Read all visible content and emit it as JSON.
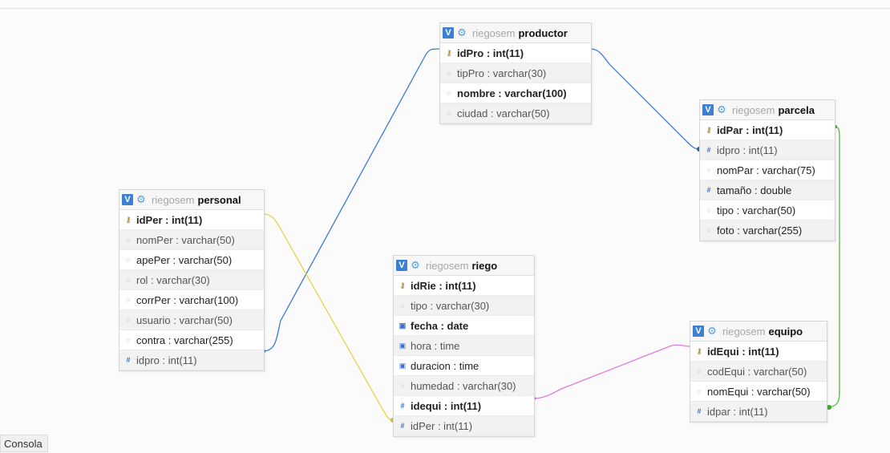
{
  "database": "riegosem",
  "tables": {
    "productor": {
      "name": "productor",
      "columns": [
        {
          "label": "idPro : int(11)",
          "icon": "key-icon"
        },
        {
          "label": "tipPro : varchar(30)",
          "icon": "column-icon"
        },
        {
          "label": "nombre : varchar(100)",
          "icon": "column-icon"
        },
        {
          "label": "ciudad : varchar(50)",
          "icon": "column-icon"
        }
      ]
    },
    "parcela": {
      "name": "parcela",
      "columns": [
        {
          "label": "idPar : int(11)",
          "icon": "key-icon"
        },
        {
          "label": "idpro : int(11)",
          "icon": "index-icon"
        },
        {
          "label": "nomPar : varchar(75)",
          "icon": "column-icon"
        },
        {
          "label": "tamaño : double",
          "icon": "index-icon"
        },
        {
          "label": "tipo : varchar(50)",
          "icon": "column-icon"
        },
        {
          "label": "foto : varchar(255)",
          "icon": "column-icon"
        }
      ]
    },
    "personal": {
      "name": "personal",
      "columns": [
        {
          "label": "idPer : int(11)",
          "icon": "key-icon"
        },
        {
          "label": "nomPer : varchar(50)",
          "icon": "column-icon"
        },
        {
          "label": "apePer : varchar(50)",
          "icon": "column-icon"
        },
        {
          "label": "rol : varchar(30)",
          "icon": "column-icon"
        },
        {
          "label": "corrPer : varchar(100)",
          "icon": "column-icon"
        },
        {
          "label": "usuario : varchar(50)",
          "icon": "column-icon"
        },
        {
          "label": "contra : varchar(255)",
          "icon": "column-icon"
        },
        {
          "label": "idpro : int(11)",
          "icon": "index-icon"
        }
      ]
    },
    "riego": {
      "name": "riego",
      "columns": [
        {
          "label": "idRie : int(11)",
          "icon": "key-icon"
        },
        {
          "label": "tipo : varchar(30)",
          "icon": "column-icon"
        },
        {
          "label": "fecha : date",
          "icon": "date-icon"
        },
        {
          "label": "hora : time",
          "icon": "date-icon"
        },
        {
          "label": "duracion : time",
          "icon": "date-icon"
        },
        {
          "label": "humedad : varchar(30)",
          "icon": "column-icon"
        },
        {
          "label": "idequi : int(11)",
          "icon": "index-icon"
        },
        {
          "label": "idPer : int(11)",
          "icon": "index-icon"
        }
      ]
    },
    "equipo": {
      "name": "equipo",
      "columns": [
        {
          "label": "idEqui : int(11)",
          "icon": "key-icon"
        },
        {
          "label": "codEqui : varchar(50)",
          "icon": "column-icon"
        },
        {
          "label": "nomEqui : varchar(50)",
          "icon": "column-icon"
        },
        {
          "label": "idpar : int(11)",
          "icon": "index-icon"
        }
      ]
    }
  },
  "header_buttons": {
    "toggle_label": "V",
    "options_icon": "gear-icon"
  },
  "relations": [
    {
      "from": "personal.idpro",
      "to": "productor.idPro",
      "color": "#3b7bd6"
    },
    {
      "from": "parcela.idpro",
      "to": "productor.idPro",
      "color": "#3b7bd6"
    },
    {
      "from": "personal.idPer",
      "to": "riego.idPer",
      "color": "#e2d23a"
    },
    {
      "from": "riego.idequi",
      "to": "equipo.idEqui",
      "color": "#e07be0"
    },
    {
      "from": "equipo.idpar",
      "to": "parcela.idPar",
      "color": "#5cc04a"
    }
  ],
  "console": {
    "label": "Consola"
  }
}
